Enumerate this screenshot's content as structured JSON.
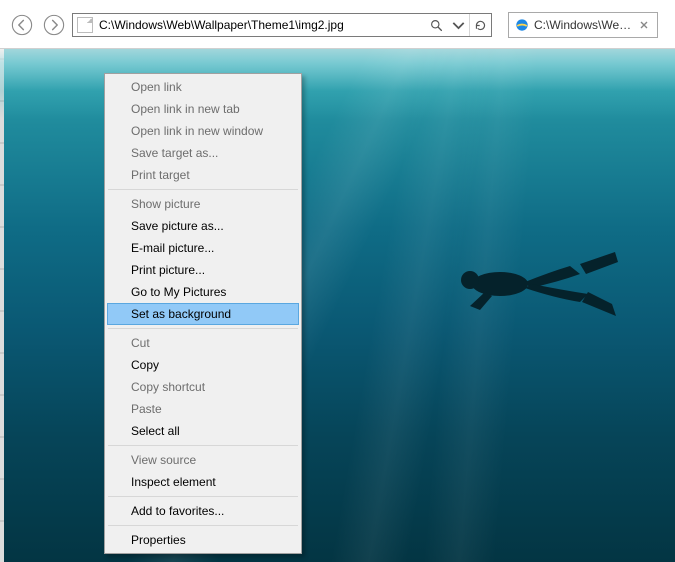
{
  "toolbar": {
    "address": "C:\\Windows\\Web\\Wallpaper\\Theme1\\img2.jpg"
  },
  "tab": {
    "title": "C:\\Windows\\Web\\Wa..."
  },
  "context_menu": {
    "open_link": "Open link",
    "open_link_new_tab": "Open link in new tab",
    "open_link_new_window": "Open link in new window",
    "save_target_as": "Save target as...",
    "print_target": "Print target",
    "show_picture": "Show picture",
    "save_picture_as": "Save picture as...",
    "email_picture": "E-mail picture...",
    "print_picture": "Print picture...",
    "go_to_my_pictures": "Go to My Pictures",
    "set_as_background": "Set as background",
    "cut": "Cut",
    "copy": "Copy",
    "copy_shortcut": "Copy shortcut",
    "paste": "Paste",
    "select_all": "Select all",
    "view_source": "View source",
    "inspect_element": "Inspect element",
    "add_to_favorites": "Add to favorites...",
    "properties": "Properties"
  }
}
